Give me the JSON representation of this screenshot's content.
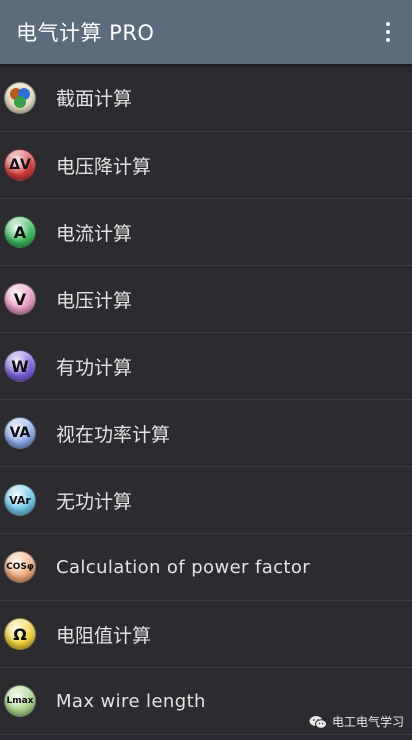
{
  "appbar": {
    "title": "电气计算 PRO",
    "menu_icon": "more-vert-icon"
  },
  "items": [
    {
      "name": "cross-section",
      "label": "截面计算",
      "icon_text": "",
      "icon": "cross-section-icon",
      "color": "#9a8a60"
    },
    {
      "name": "voltage-drop",
      "label": "电压降计算",
      "icon_text": "ΔV",
      "icon": "voltage-drop-icon",
      "color": "#d23a3a"
    },
    {
      "name": "current",
      "label": "电流计算",
      "icon_text": "A",
      "icon": "current-icon",
      "color": "#3bb85a"
    },
    {
      "name": "voltage",
      "label": "电压计算",
      "icon_text": "V",
      "icon": "voltage-icon",
      "color": "#e79ac3"
    },
    {
      "name": "active-power",
      "label": "有功计算",
      "icon_text": "W",
      "icon": "active-power-icon",
      "color": "#7b5fd6"
    },
    {
      "name": "apparent-power",
      "label": "视在功率计算",
      "icon_text": "VA",
      "icon": "apparent-power-icon",
      "color": "#8aa9e8"
    },
    {
      "name": "reactive-power",
      "label": "无功计算",
      "icon_text": "VAr",
      "icon": "reactive-power-icon",
      "color": "#6fc7e8"
    },
    {
      "name": "power-factor",
      "label": "Calculation of power factor",
      "icon_text": "COSφ",
      "icon": "power-factor-icon",
      "color": "#f0a87a"
    },
    {
      "name": "resistance",
      "label": "电阻值计算",
      "icon_text": "Ω",
      "icon": "resistance-icon",
      "color": "#f2d23a"
    },
    {
      "name": "max-wire-length",
      "label": "Max wire length",
      "icon_text": "Lmax",
      "icon": "max-wire-length-icon",
      "color": "#a9d48a"
    }
  ],
  "watermark": {
    "text": "电工电气学习",
    "icon": "wechat-icon"
  }
}
